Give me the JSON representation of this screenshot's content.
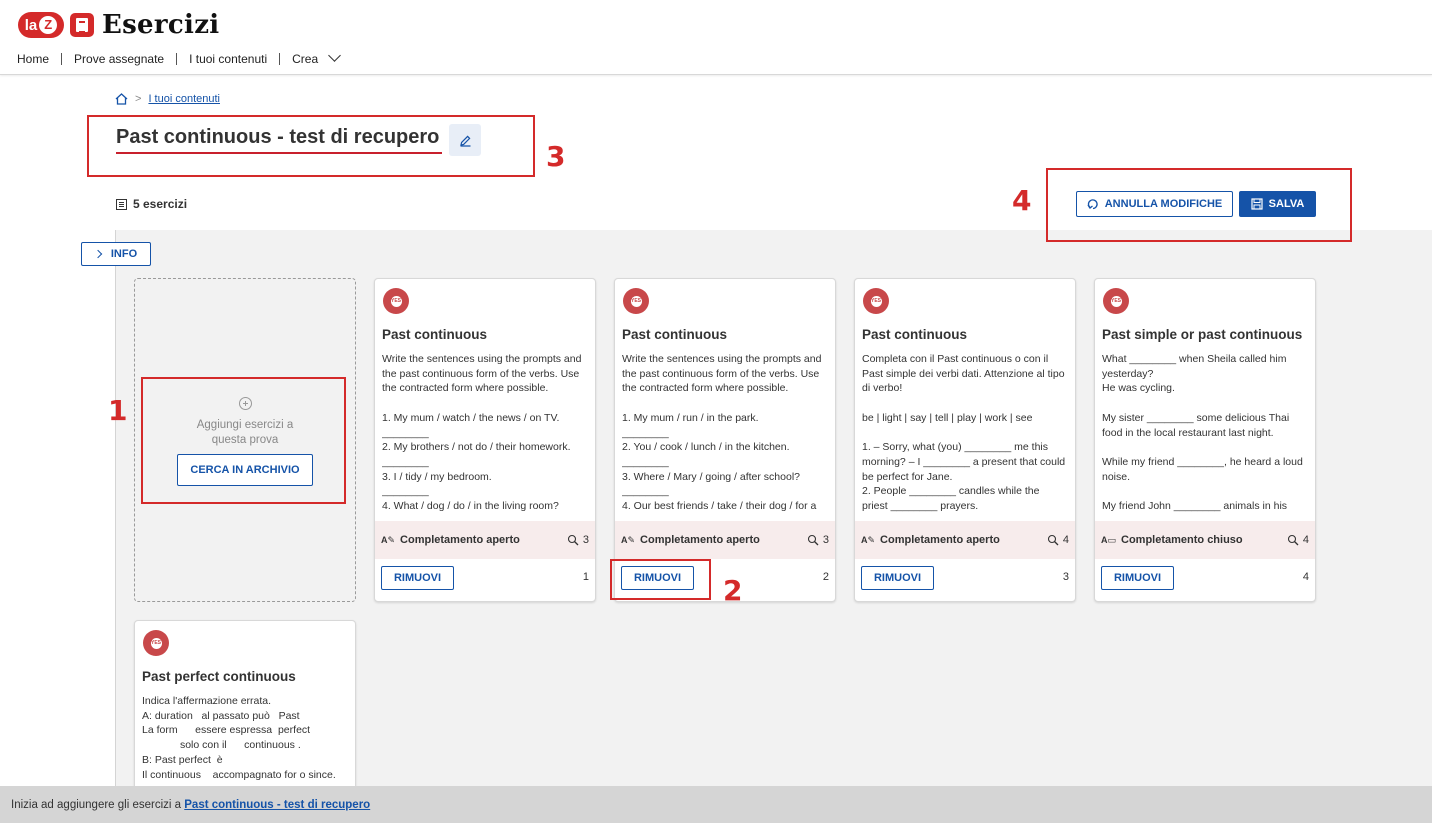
{
  "header": {
    "logo_text": "la",
    "logo_z": "Z",
    "app_title": "Esercizi",
    "nav": [
      "Home",
      "Prove assegnate",
      "I tuoi contenuti",
      "Crea"
    ]
  },
  "breadcrumb": {
    "link": "I tuoi contenuti"
  },
  "page": {
    "title": "Past continuous - test di recupero",
    "exercise_count": "5 esercizi",
    "cancel_label": "ANNULLA MODIFICHE",
    "save_label": "SALVA",
    "info_label": "INFO"
  },
  "add_card": {
    "text": "Aggiungi esercizi a questa prova",
    "button": "CERCA IN ARCHIVIO"
  },
  "cards": [
    {
      "badge": "YES",
      "title": "Past continuous",
      "body": "Write the sentences using the prompts and the past continuous form of the verbs. Use the contracted form where possible.\n\n1. My mum / watch / the news / on TV.\n________\n2. My brothers / not do / their homework.\n________\n3. I / tidy / my bedroom.\n________\n4. What / dog / do / in the living room?",
      "type": "Completamento aperto",
      "type_icon": "A✎",
      "count": "3",
      "remove": "RIMUOVI",
      "number": "1"
    },
    {
      "badge": "YES",
      "title": "Past continuous",
      "body": "Write the sentences using the prompts and the past continuous form of the verbs. Use the contracted form where possible.\n\n1. My mum / run / in the park.\n________\n2. You / cook / lunch / in the kitchen.\n________\n3. Where / Mary / going / after school?\n________\n4. Our best friends / take / their dog / for a",
      "type": "Completamento aperto",
      "type_icon": "A✎",
      "count": "3",
      "remove": "RIMUOVI",
      "number": "2"
    },
    {
      "badge": "YES",
      "title": "Past continuous",
      "body": "Completa con il Past continuous o con il Past simple dei verbi dati. Attenzione al tipo di verbo!\n\nbe | light | say | tell | play | work | see\n\n1. – Sorry, what (you) ________ me this morning? – I ________ a present that could be perfect for Jane.\n2. People ________ candles while the priest ________ prayers.",
      "type": "Completamento aperto",
      "type_icon": "A✎",
      "count": "4",
      "remove": "RIMUOVI",
      "number": "3"
    },
    {
      "badge": "YES",
      "title": "Past simple or past continuous",
      "body": "What ________ when Sheila called him yesterday?\nHe was cycling.\n\nMy sister ________ some delicious Thai food in the local restaurant last night.\n\nWhile my friend ________, he heard a loud noise.\n\nMy friend John ________ animals in his",
      "type": "Completamento chiuso",
      "type_icon": "A▭",
      "count": "4",
      "remove": "RIMUOVI",
      "number": "4"
    },
    {
      "badge": "YES",
      "title": "Past perfect continuous",
      "body": "Indica l'affermazione errata.\nA: duration   al passato può   Past\nLa form      essere espressa  perfect\n             solo con il      continuous .\nB: Past perfect  è\nIl continuous    accompagnato for o since.",
      "type": "",
      "type_icon": "",
      "count": "",
      "remove": "",
      "number": ""
    }
  ],
  "bottom_bar": {
    "prefix": "Inizia ad aggiungere gli esercizi a ",
    "link": "Past continuous - test di recupero"
  },
  "annotations": [
    "1",
    "2",
    "3",
    "4"
  ],
  "colors": {
    "accent": "#1553a8",
    "brand_red": "#d42a2a",
    "annotation_red": "#d42a2a",
    "badge": "#c8484a",
    "card_type_bg": "#f7ecec"
  }
}
